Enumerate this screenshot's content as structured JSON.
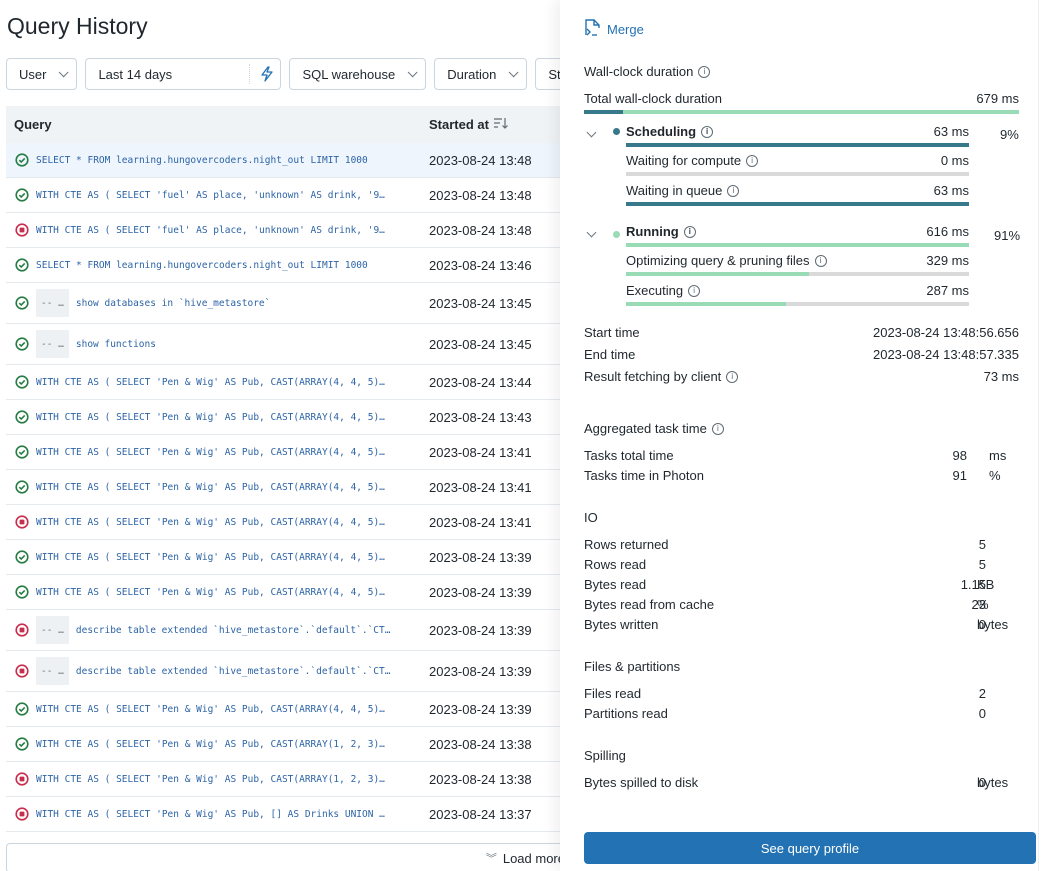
{
  "page": {
    "title": "Query History"
  },
  "filters": {
    "user": "User",
    "date_range": "Last 14 days",
    "warehouse": "SQL warehouse",
    "duration": "Duration",
    "status_partial": "St"
  },
  "table": {
    "columns": {
      "query": "Query",
      "started_at": "Started at"
    },
    "rows": [
      {
        "status": "success",
        "comment": "",
        "query": "SELECT * FROM learning.hungovercoders.night_out LIMIT 1000",
        "started_at": "2023-08-24 13:48",
        "selected": true
      },
      {
        "status": "success",
        "comment": "",
        "query": "WITH CTE AS ( SELECT 'fuel' AS place, 'unknown' AS drink, '9…",
        "started_at": "2023-08-24 13:48"
      },
      {
        "status": "failed",
        "comment": "",
        "query": "WITH CTE AS ( SELECT 'fuel' AS place, 'unknown' AS drink, '9…",
        "started_at": "2023-08-24 13:48"
      },
      {
        "status": "success",
        "comment": "",
        "query": "SELECT * FROM learning.hungovercoders.night_out LIMIT 1000",
        "started_at": "2023-08-24 13:46"
      },
      {
        "status": "success",
        "comment": "-- …",
        "query": "show databases in `hive_metastore`",
        "started_at": "2023-08-24 13:45"
      },
      {
        "status": "success",
        "comment": "-- …",
        "query": "show functions",
        "started_at": "2023-08-24 13:45"
      },
      {
        "status": "success",
        "comment": "",
        "query": "WITH CTE AS ( SELECT 'Pen & Wig' AS Pub, CAST(ARRAY(4, 4, 5)…",
        "started_at": "2023-08-24 13:44"
      },
      {
        "status": "success",
        "comment": "",
        "query": "WITH CTE AS ( SELECT 'Pen & Wig' AS Pub, CAST(ARRAY(4, 4, 5)…",
        "started_at": "2023-08-24 13:43"
      },
      {
        "status": "success",
        "comment": "",
        "query": "WITH CTE AS ( SELECT 'Pen & Wig' AS Pub, CAST(ARRAY(4, 4, 5)…",
        "started_at": "2023-08-24 13:41"
      },
      {
        "status": "success",
        "comment": "",
        "query": "WITH CTE AS ( SELECT 'Pen & Wig' AS Pub, CAST(ARRAY(4, 4, 5)…",
        "started_at": "2023-08-24 13:41"
      },
      {
        "status": "failed",
        "comment": "",
        "query": "WITH CTE AS ( SELECT 'Pen & Wig' AS Pub, CAST(ARRAY(4, 4, 5)…",
        "started_at": "2023-08-24 13:41"
      },
      {
        "status": "success",
        "comment": "",
        "query": "WITH CTE AS ( SELECT 'Pen & Wig' AS Pub, CAST(ARRAY(4, 4, 5)…",
        "started_at": "2023-08-24 13:39"
      },
      {
        "status": "success",
        "comment": "",
        "query": "WITH CTE AS ( SELECT 'Pen & Wig' AS Pub, CAST(ARRAY(4, 4, 5)…",
        "started_at": "2023-08-24 13:39"
      },
      {
        "status": "failed",
        "comment": "-- …",
        "query": "describe table extended `hive_metastore`.`default`.`CT…",
        "started_at": "2023-08-24 13:39"
      },
      {
        "status": "failed",
        "comment": "-- …",
        "query": "describe table extended `hive_metastore`.`default`.`CT…",
        "started_at": "2023-08-24 13:39"
      },
      {
        "status": "success",
        "comment": "",
        "query": "WITH CTE AS ( SELECT 'Pen & Wig' AS Pub, CAST(ARRAY(4, 4, 5)…",
        "started_at": "2023-08-24 13:39"
      },
      {
        "status": "success",
        "comment": "",
        "query": "WITH CTE AS ( SELECT 'Pen & Wig' AS Pub, CAST(ARRAY(1, 2, 3)…",
        "started_at": "2023-08-24 13:38"
      },
      {
        "status": "failed",
        "comment": "",
        "query": "WITH CTE AS ( SELECT 'Pen & Wig' AS Pub, CAST(ARRAY(1, 2, 3)…",
        "started_at": "2023-08-24 13:38"
      },
      {
        "status": "failed",
        "comment": "",
        "query": "WITH CTE AS ( SELECT 'Pen & Wig' AS Pub, [] AS Drinks UNION …",
        "started_at": "2023-08-24 13:37"
      }
    ],
    "load_more": "Load more"
  },
  "panel": {
    "merge_label": "Merge",
    "wall_clock": {
      "title": "Wall-clock duration",
      "total_label": "Total wall-clock duration",
      "total_value": "679 ms",
      "scheduling_fraction": 0.09,
      "scheduling": {
        "label": "Scheduling",
        "value": "63 ms",
        "pct": "9%",
        "fill": 1.0
      },
      "waiting_compute": {
        "label": "Waiting for compute",
        "value": "0 ms",
        "fill": 0.0
      },
      "waiting_queue": {
        "label": "Waiting in queue",
        "value": "63 ms",
        "fill": 1.0
      },
      "running": {
        "label": "Running",
        "value": "616 ms",
        "pct": "91%",
        "fill": 1.0
      },
      "optimizing": {
        "label": "Optimizing query & pruning files",
        "value": "329 ms",
        "fill": 0.534
      },
      "executing": {
        "label": "Executing",
        "value": "287 ms",
        "fill": 0.466
      }
    },
    "times": {
      "start_label": "Start time",
      "start_value": "2023-08-24 13:48:56.656",
      "end_label": "End time",
      "end_value": "2023-08-24 13:48:57.335",
      "fetch_label": "Result fetching by client",
      "fetch_value": "73 ms"
    },
    "aggregated": {
      "title": "Aggregated task time",
      "total_label": "Tasks total time",
      "total_num": "98",
      "total_unit": "ms",
      "photon_label": "Tasks time in Photon",
      "photon_num": "91",
      "photon_unit": "%"
    },
    "io": {
      "title": "IO",
      "rows": [
        {
          "label": "Rows returned",
          "num": "5",
          "unit": ""
        },
        {
          "label": "Rows read",
          "num": "5",
          "unit": ""
        },
        {
          "label": "Bytes read",
          "num": "1.15",
          "unit": "KB"
        },
        {
          "label": "Bytes read from cache",
          "num": "23",
          "unit": "%"
        },
        {
          "label": "Bytes written",
          "num": "0",
          "unit": "bytes"
        }
      ]
    },
    "files": {
      "title": "Files & partitions",
      "rows": [
        {
          "label": "Files read",
          "num": "2",
          "unit": ""
        },
        {
          "label": "Partitions read",
          "num": "0",
          "unit": ""
        }
      ]
    },
    "spilling": {
      "title": "Spilling",
      "rows": [
        {
          "label": "Bytes spilled to disk",
          "num": "0",
          "unit": "bytes"
        }
      ]
    },
    "profile_button": "See query profile"
  },
  "colors": {
    "accent": "#2272b4",
    "teal": "#37798a",
    "green": "#99dbb4",
    "success": "#277c43",
    "failed": "#c82d4c"
  }
}
